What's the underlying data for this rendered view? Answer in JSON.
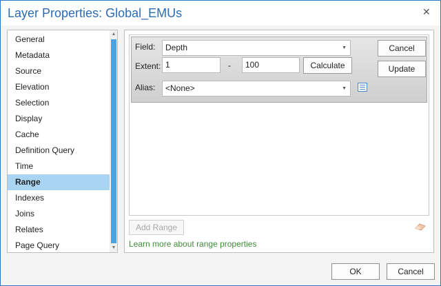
{
  "window": {
    "title": "Layer Properties: Global_EMUs",
    "close_glyph": "✕"
  },
  "nav": {
    "items": [
      {
        "label": "General"
      },
      {
        "label": "Metadata"
      },
      {
        "label": "Source"
      },
      {
        "label": "Elevation"
      },
      {
        "label": "Selection"
      },
      {
        "label": "Display"
      },
      {
        "label": "Cache"
      },
      {
        "label": "Definition Query"
      },
      {
        "label": "Time"
      },
      {
        "label": "Range",
        "selected": true
      },
      {
        "label": "Indexes"
      },
      {
        "label": "Joins"
      },
      {
        "label": "Relates"
      },
      {
        "label": "Page Query"
      }
    ],
    "scroll_up_glyph": "▲",
    "scroll_down_glyph": "▼"
  },
  "range": {
    "field_label": "Field:",
    "field_value": "Depth",
    "extent_label": "Extent:",
    "extent_min": "1",
    "extent_dash": "-",
    "extent_max": "100",
    "calculate_label": "Calculate",
    "alias_label": "Alias:",
    "alias_value": "<None>",
    "cancel_label": "Cancel",
    "update_label": "Update",
    "add_range_label": "Add Range",
    "learn_more_label": "Learn more about range properties",
    "dropdown_glyph": "▼",
    "icons": [
      "list-icon",
      "eraser-icon"
    ]
  },
  "footer": {
    "ok_label": "OK",
    "cancel_label": "Cancel"
  },
  "colors": {
    "title": "#2b6cb3",
    "selection": "#a9d4f2",
    "scrollbar_thumb": "#4da3df",
    "link": "#3f8b3a",
    "window_border": "#2b78c6"
  }
}
